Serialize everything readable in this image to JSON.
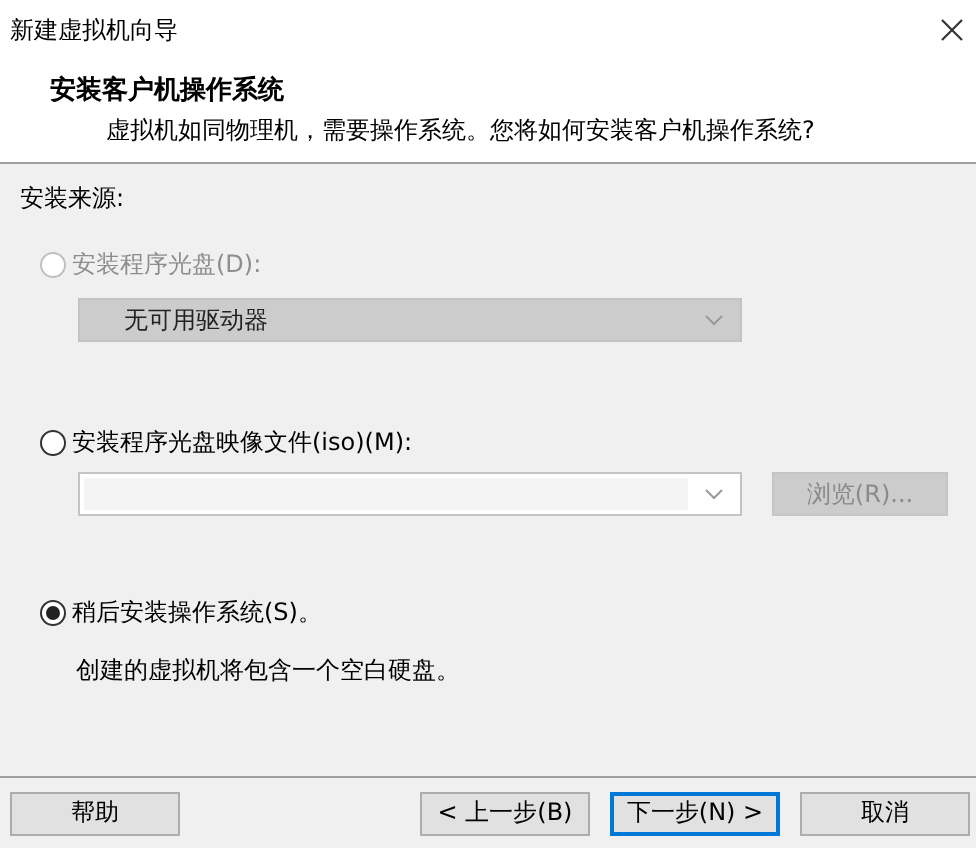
{
  "window": {
    "title": "新建虚拟机向导"
  },
  "header": {
    "title": "安装客户机操作系统",
    "subtitle": "虚拟机如同物理机，需要操作系统。您将如何安装客户机操作系统?"
  },
  "section_label": "安装来源:",
  "options": [
    {
      "kind": "disc",
      "label": "安装程序光盘(D):",
      "selected": false,
      "disabled": true,
      "dropdown": {
        "value": "无可用驱动器",
        "disabled": true
      }
    },
    {
      "kind": "iso",
      "label": "安装程序光盘映像文件(iso)(M):",
      "selected": false,
      "disabled": false,
      "browse_button": {
        "label": "浏览(R)...",
        "disabled": true
      }
    },
    {
      "kind": "later",
      "label": "稍后安装操作系统(S)。",
      "selected": true,
      "disabled": false,
      "description": "创建的虚拟机将包含一个空白硬盘。"
    }
  ],
  "buttons": [
    {
      "label": "帮助",
      "kind": "help",
      "focused": false
    },
    {
      "label": "< 上一步(B)",
      "kind": "nav",
      "focused": false
    },
    {
      "label": "下一步(N) >",
      "kind": "nav",
      "focused": true
    },
    {
      "label": "取消",
      "kind": "nav",
      "focused": false
    }
  ]
}
